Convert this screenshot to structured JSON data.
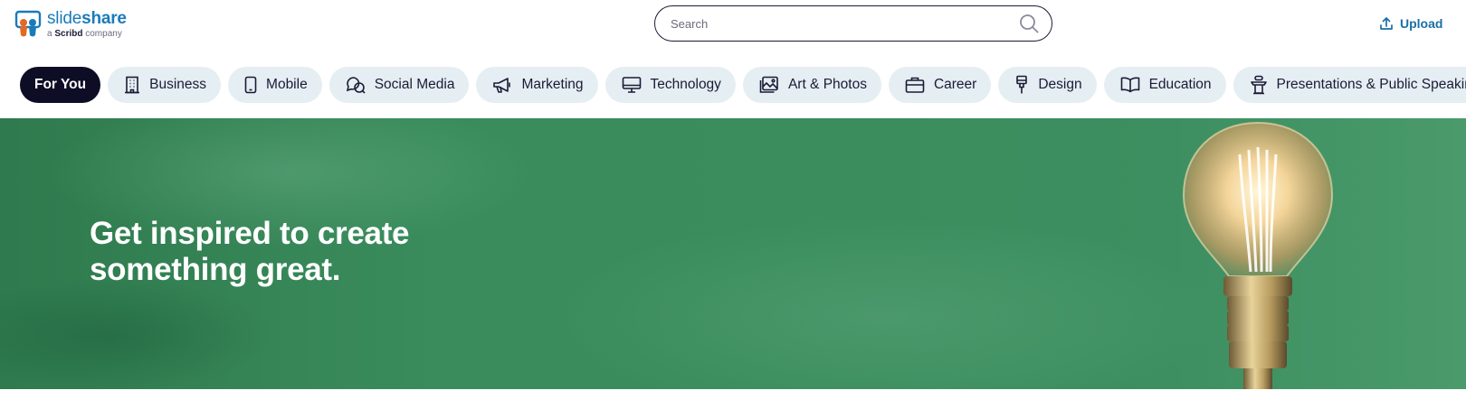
{
  "header": {
    "logo": {
      "word_light": "slide",
      "word_bold": "share",
      "sub_prefix": "a ",
      "sub_brand": "Scribd",
      "sub_suffix": " company"
    },
    "search": {
      "placeholder": "Search",
      "value": ""
    },
    "upload_label": "Upload"
  },
  "categories": [
    {
      "label": "For You",
      "active": true,
      "icon": "none"
    },
    {
      "label": "Business",
      "icon": "building-icon"
    },
    {
      "label": "Mobile",
      "icon": "phone-icon"
    },
    {
      "label": "Social Media",
      "icon": "chat-bubbles-icon"
    },
    {
      "label": "Marketing",
      "icon": "megaphone-icon"
    },
    {
      "label": "Technology",
      "icon": "monitor-icon"
    },
    {
      "label": "Art & Photos",
      "icon": "image-icon"
    },
    {
      "label": "Career",
      "icon": "briefcase-icon"
    },
    {
      "label": "Design",
      "icon": "paint-brush-icon"
    },
    {
      "label": "Education",
      "icon": "open-book-icon"
    },
    {
      "label": "Presentations & Public Speaking",
      "icon": "podium-icon"
    }
  ],
  "hero": {
    "title_line1": "Get inspired to create",
    "title_line2": "something great."
  },
  "colors": {
    "brand": "#1a7bb9",
    "upload": "#1a6fa6",
    "chip_bg": "#e5eef3",
    "chip_active": "#0d0d26",
    "hero_green": "#3a8c5c"
  }
}
